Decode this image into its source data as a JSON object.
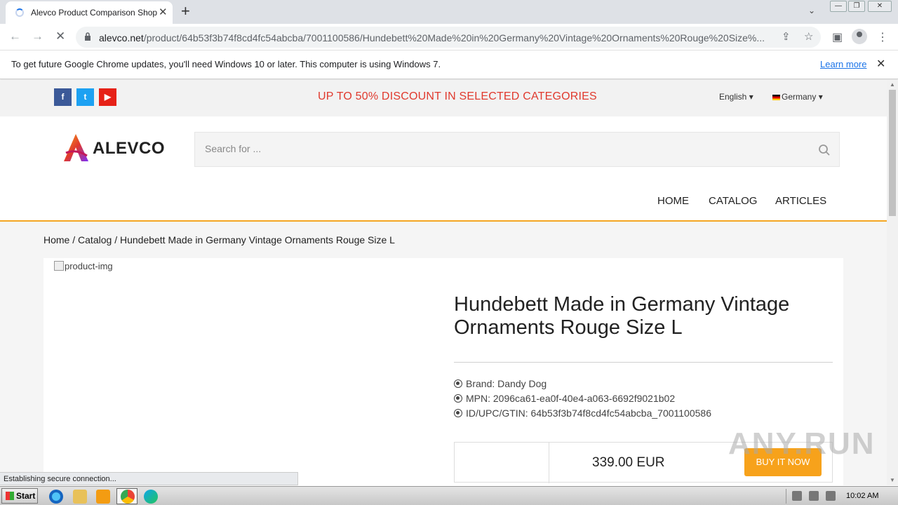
{
  "browser": {
    "tab_title": "Alevco Product Comparison Shopping",
    "url_host": "alevco.net",
    "url_path": "/product/64b53f3b74f8cd4fc54abcba/7001100586/Hundebett%20Made%20in%20Germany%20Vintage%20Ornaments%20Rouge%20Size%..."
  },
  "infobar": {
    "message": "To get future Google Chrome updates, you'll need Windows 10 or later. This computer is using Windows 7.",
    "link": "Learn more"
  },
  "site": {
    "promo": "UP TO 50% DISCOUNT IN SELECTED CATEGORIES",
    "language": "English",
    "country": "Germany",
    "logo_text": "ALEVCO",
    "search_placeholder": "Search for ...",
    "menu": [
      "HOME",
      "CATALOG",
      "ARTICLES"
    ]
  },
  "breadcrumb": {
    "home": "Home",
    "sep1": "/",
    "catalog": "Catalog",
    "sep2": "/",
    "current": "Hundebett Made in Germany Vintage Ornaments Rouge Size L"
  },
  "product": {
    "image_alt": "product-img",
    "title": "Hundebett Made in Germany Vintage Ornaments Rouge Size L",
    "brand": "Brand: Dandy Dog",
    "mpn": "MPN: 2096ca61-ea0f-40e4-a063-6692f9021b02",
    "gtin": "ID/UPC/GTIN: 64b53f3b74f8cd4fc54abcba_7001100586",
    "price": "339.00 EUR",
    "buy_label": "BUY IT NOW"
  },
  "status_text": "Establishing secure connection...",
  "watermark": "ANY.RUN",
  "taskbar": {
    "start": "Start",
    "time": "10:02 AM"
  },
  "colors": {
    "accent": "#f5a623",
    "promo": "#e0392d",
    "buy": "#f7a21b",
    "facebook": "#3b5998",
    "twitter": "#1da1f2",
    "youtube": "#e62117"
  }
}
